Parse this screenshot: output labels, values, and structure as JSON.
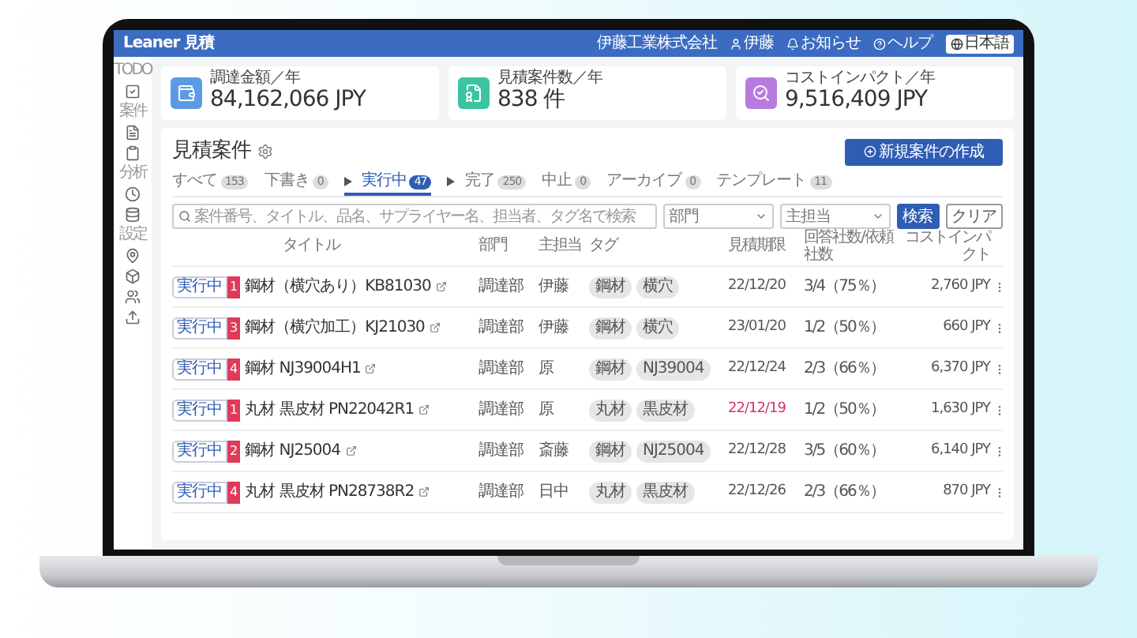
{
  "header": {
    "logo": "Leaner 見積",
    "company": "伊藤工業株式会社",
    "user": "伊藤",
    "notifications": "お知らせ",
    "help": "ヘルプ",
    "language": "日本語"
  },
  "sidebar": {
    "sections": [
      {
        "label": "TODO"
      },
      {
        "label": "案件"
      },
      {
        "label": "分析"
      },
      {
        "label": "設定"
      }
    ]
  },
  "stats": [
    {
      "label": "調達金額／年",
      "value": "84,162,066 JPY",
      "color": "#5b9be6"
    },
    {
      "label": "見積案件数／年",
      "value": "838 件",
      "color": "#3cc4a0"
    },
    {
      "label": "コストインパクト／年",
      "value": "9,516,409 JPY",
      "color": "#b77be0"
    }
  ],
  "page": {
    "title": "見積案件",
    "create_button": "新規案件の作成"
  },
  "tabs": [
    {
      "label": "すべて",
      "count": "153",
      "selected": false,
      "kind": "plain"
    },
    {
      "label": "下書き",
      "count": "0",
      "selected": false,
      "kind": "plain"
    },
    {
      "label": "実行中",
      "count": "47",
      "selected": true,
      "kind": "step"
    },
    {
      "label": "完了",
      "count": "250",
      "selected": false,
      "kind": "step"
    },
    {
      "label": "中止",
      "count": "0",
      "selected": false,
      "kind": "plain"
    },
    {
      "label": "アーカイブ",
      "count": "0",
      "selected": false,
      "kind": "plain"
    },
    {
      "label": "テンプレート",
      "count": "11",
      "selected": false,
      "kind": "plain"
    }
  ],
  "filters": {
    "search_placeholder": "案件番号、タイトル、品名、サプライヤー名、担当者、タグ名で検索",
    "department": "部門",
    "owner": "主担当",
    "search_button": "検索",
    "clear_button": "クリア"
  },
  "table": {
    "columns": [
      "タイトル",
      "部門",
      "主担当",
      "タグ",
      "見積期限",
      "回答社数/依頼社数",
      "コストインパクト"
    ],
    "rows": [
      {
        "status": "実行中",
        "count": "1",
        "title": "鋼材（横穴あり）KB81030",
        "department": "調達部",
        "owner": "伊藤",
        "tags": [
          "鋼材",
          "横穴"
        ],
        "deadline": "22/12/20",
        "overdue": false,
        "responses": "3/4（75％）",
        "impact": "2,760 JPY"
      },
      {
        "status": "実行中",
        "count": "3",
        "title": "鋼材（横穴加工）KJ21030",
        "department": "調達部",
        "owner": "伊藤",
        "tags": [
          "鋼材",
          "横穴"
        ],
        "deadline": "23/01/20",
        "overdue": false,
        "responses": "1/2（50％）",
        "impact": "660 JPY"
      },
      {
        "status": "実行中",
        "count": "4",
        "title": "鋼材 NJ39004H1",
        "department": "調達部",
        "owner": "原",
        "tags": [
          "鋼材",
          "NJ39004"
        ],
        "deadline": "22/12/24",
        "overdue": false,
        "responses": "2/3（66％）",
        "impact": "6,370 JPY"
      },
      {
        "status": "実行中",
        "count": "1",
        "title": "丸材 黒皮材 PN22042R1",
        "department": "調達部",
        "owner": "原",
        "tags": [
          "丸材",
          "黒皮材"
        ],
        "deadline": "22/12/19",
        "overdue": true,
        "responses": "1/2（50％）",
        "impact": "1,630 JPY"
      },
      {
        "status": "実行中",
        "count": "2",
        "title": "鋼材 NJ25004",
        "department": "調達部",
        "owner": "斎藤",
        "tags": [
          "鋼材",
          "NJ25004"
        ],
        "deadline": "22/12/28",
        "overdue": false,
        "responses": "3/5（60％）",
        "impact": "6,140 JPY"
      },
      {
        "status": "実行中",
        "count": "4",
        "title": "丸材 黒皮材 PN28738R2",
        "department": "調達部",
        "owner": "日中",
        "tags": [
          "丸材",
          "黒皮材"
        ],
        "deadline": "22/12/26",
        "overdue": false,
        "responses": "2/3（66％）",
        "impact": "870 JPY"
      }
    ]
  }
}
